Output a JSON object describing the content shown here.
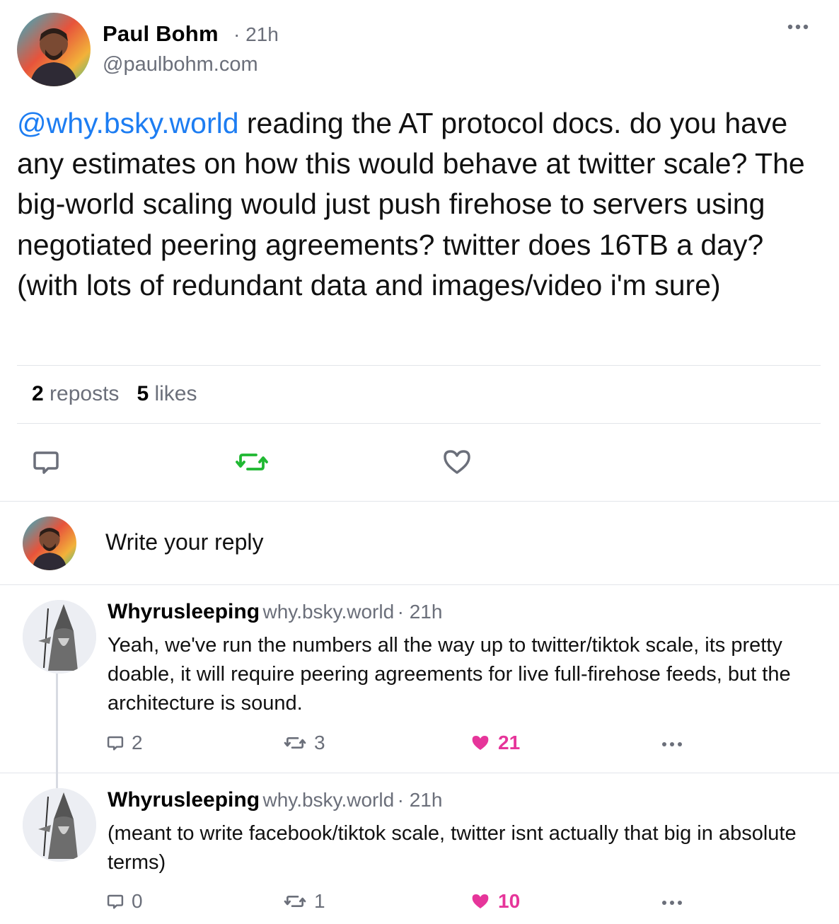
{
  "colors": {
    "link": "#1d7df2",
    "muted": "#6b6f7a",
    "repost_active": "#20b832",
    "like_active": "#e6359a",
    "divider": "#e3e5ea"
  },
  "post": {
    "author_name": "Paul Bohm",
    "time": "· 21h",
    "handle": "@paulbohm.com",
    "mention": "@why.bsky.world",
    "text": " reading the AT protocol docs. do you have any estimates on how this would behave at twitter scale? The big-world scaling would just push firehose to servers using negotiated peering agreements? twitter does 16TB a day? (with lots of redundant data and images/video i'm sure)",
    "reposts_count": "2",
    "reposts_label": "reposts",
    "likes_count": "5",
    "likes_label": "likes",
    "icons": {
      "more": "more-icon",
      "reply": "reply-icon",
      "repost": "repost-icon",
      "like": "heart-icon"
    }
  },
  "composer": {
    "placeholder": "Write your reply"
  },
  "replies": [
    {
      "name": "Whyrusleeping",
      "handle": "why.bsky.world",
      "time": "· 21h",
      "text": "Yeah, we've run the numbers all the way up to twitter/tiktok scale, its pretty doable, it will require peering agreements for live full-firehose feeds, but the architecture is sound.",
      "reply_count": "2",
      "repost_count": "3",
      "like_count": "21"
    },
    {
      "name": "Whyrusleeping",
      "handle": "why.bsky.world",
      "time": "· 21h",
      "text": "(meant to write facebook/tiktok scale, twitter isnt actually that big in absolute terms)",
      "reply_count": "0",
      "repost_count": "1",
      "like_count": "10"
    }
  ]
}
